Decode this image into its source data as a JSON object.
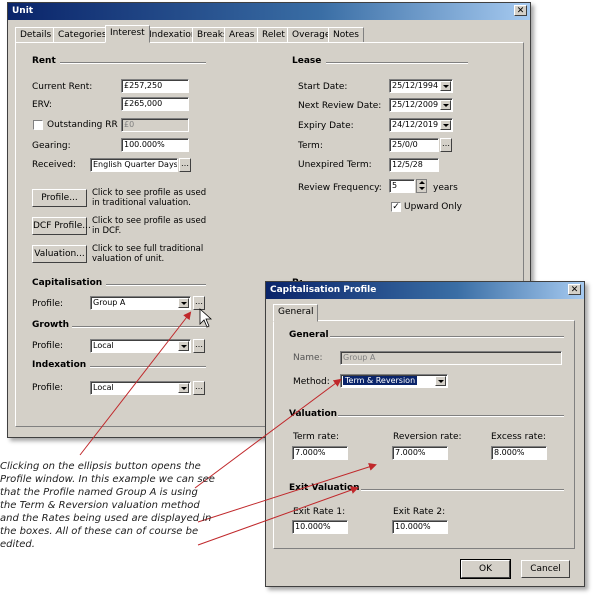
{
  "unit_window": {
    "title": "Unit",
    "close_glyph": "✕",
    "tabs": [
      "Details",
      "Categories",
      "Interest",
      "Indexation",
      "Breaks",
      "Areas",
      "Relet",
      "Overage",
      "Notes"
    ],
    "active_tab": "Interest",
    "rent": {
      "heading": "Rent",
      "current_rent_label": "Current Rent:",
      "current_rent": "£257,250",
      "erv_label": "ERV:",
      "erv": "£265,000",
      "outstanding_rr_label": "Outstanding RR",
      "outstanding_rr": "£0",
      "gearing_label": "Gearing:",
      "gearing": "100.000%",
      "received_label": "Received:",
      "received": "English Quarter Days"
    },
    "buttons": {
      "profile": "Profile...",
      "profile_desc": "Click to see profile as used in traditional valuation.",
      "dcf_profile": "DCF Profile...",
      "dcf_desc": "Click to see profile as used in DCF.",
      "valuation": "Valuation...",
      "valuation_desc": "Click to see full traditional valuation of unit."
    },
    "capitalisation": {
      "heading": "Capitalisation",
      "profile_label": "Profile:",
      "profile": "Group A"
    },
    "growth": {
      "heading": "Growth",
      "profile_label": "Profile:",
      "profile": "Local"
    },
    "indexation": {
      "heading": "Indexation",
      "profile_label": "Profile:",
      "profile": "Local"
    },
    "lease": {
      "heading": "Lease",
      "start_date_label": "Start Date:",
      "start_date": "25/12/1994",
      "next_review_label": "Next Review Date:",
      "next_review": "25/12/2009",
      "expiry_label": "Expiry Date:",
      "expiry": "24/12/2019",
      "term_label": "Term:",
      "term": "25/0/0",
      "unexpired_label": "Unexpired Term:",
      "unexpired": "12/5/28",
      "review_freq_label": "Review Frequency:",
      "review_freq": "5",
      "years": "years",
      "upward_only_label": "Upward Only",
      "upward_only_checked": true
    },
    "hidden_heading_fragment": "Period"
  },
  "cap_window": {
    "title": "Capitalisation Profile",
    "close_glyph": "✕",
    "tab": "General",
    "general": {
      "heading": "General",
      "name_label": "Name:",
      "name": "Group A",
      "method_label": "Method:",
      "method": "Term & Reversion"
    },
    "valuation": {
      "heading": "Valuation",
      "term_rate_label": "Term rate:",
      "term_rate": "7.000%",
      "reversion_rate_label": "Reversion rate:",
      "reversion_rate": "7.000%",
      "excess_rate_label": "Excess rate:",
      "excess_rate": "8.000%"
    },
    "exit_valuation": {
      "heading": "Exit Valuation",
      "exit_rate1_label": "Exit Rate 1:",
      "exit_rate1": "10.000%",
      "exit_rate2_label": "Exit Rate 2:",
      "exit_rate2": "10.000%"
    },
    "ok": "OK",
    "cancel": "Cancel"
  },
  "annotation": "Clicking on the ellipsis button opens the Profile window. In this example we can see that the Profile named Group A is using the Term & Reversion valuation method and the Rates being used are displayed in the boxes. All of these can of course be edited.",
  "colors": {
    "window_bg": "#d4d0c8",
    "title_start": "#0a246a",
    "title_end": "#a6caf0",
    "arrow": "#c0282b"
  }
}
